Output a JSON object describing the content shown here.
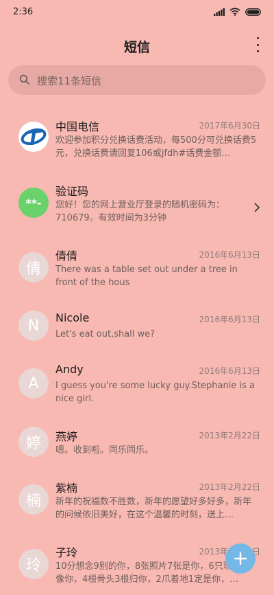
{
  "status": {
    "time": "2:36"
  },
  "header": {
    "title": "短信",
    "more_icon": "more-vertical-icon"
  },
  "search": {
    "placeholder": "搜索11条短信"
  },
  "colors": {
    "background": "#f7b9b2",
    "search_bg": "#e6a9a3",
    "avatar_bg": "#e9d7d5",
    "fab": "#75b8e6",
    "verify_green": "#69d26b",
    "telecom_blue": "#1a66b3"
  },
  "messages": [
    {
      "sender": "中国电信",
      "date": "2017年6月30日",
      "preview": "欢迎参加积分兑换话费活动，每500分可兑换话费5元，兑换话费请回复106或jfdh#话费金额…",
      "avatar": "telecom-logo"
    },
    {
      "sender": "验证码",
      "date": "",
      "preview": "您好！您的网上营业厅登录的随机密码为：710679。有效时间为3分钟",
      "avatar_text": "**-"
    },
    {
      "sender": "倩倩",
      "date": "2016年6月13日",
      "preview": "There was a table set out under a tree in front of the hous",
      "avatar_text": "倩"
    },
    {
      "sender": "Nicole",
      "date": "2016年6月13日",
      "preview": "Let's eat out,shall we?",
      "avatar_text": "N"
    },
    {
      "sender": "Andy",
      "date": "2016年6月13日",
      "preview": "I guess you're some lucky guy.Stephanie is a nice girl.",
      "avatar_text": "A"
    },
    {
      "sender": "燕婷",
      "date": "2013年2月22日",
      "preview": "嗯。收到啦。同乐同乐。",
      "avatar_text": "婷"
    },
    {
      "sender": "紫楠",
      "date": "2013年2月22日",
      "preview": "新年的祝福数不胜数，新年的愿望好多好多，新年的问候依旧美好，在这个温馨的时刻，送上…",
      "avatar_text": "楠"
    },
    {
      "sender": "子玲",
      "date": "2013年2月22日",
      "preview": "10分想念9别的你，8张照片7张是你，6只现在只像你，4根骨头3根归你，2爪着地1定是你，…",
      "avatar_text": "玲"
    }
  ],
  "fab": {
    "icon": "plus-icon"
  }
}
